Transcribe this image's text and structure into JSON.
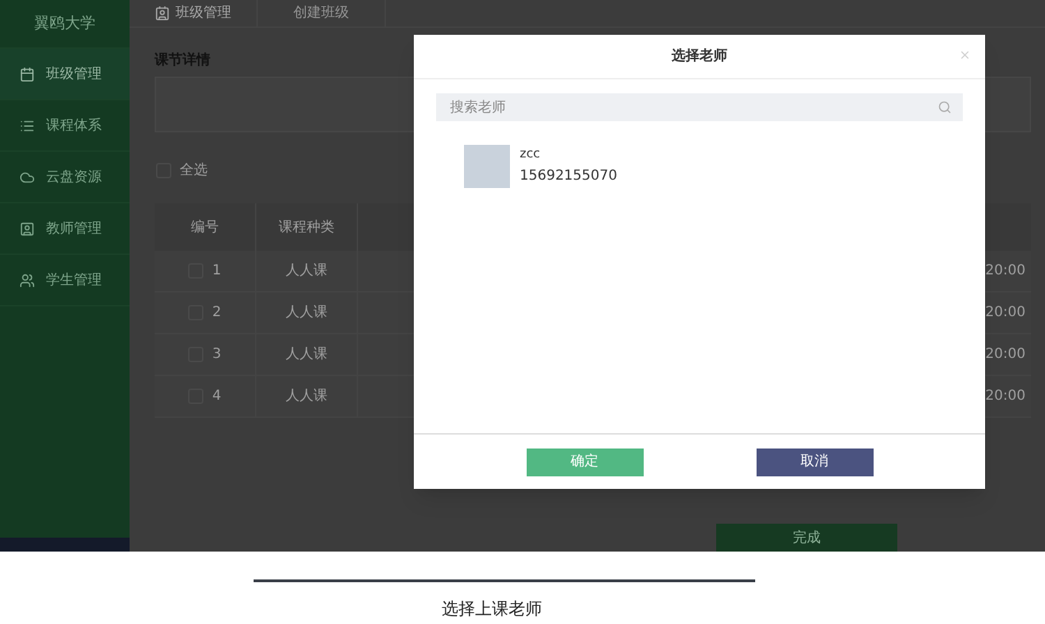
{
  "sidebar": {
    "title": "翼鸥大学",
    "items": [
      {
        "label": "班级管理",
        "kind": "calendar",
        "selected": true
      },
      {
        "label": "课程体系",
        "kind": "list",
        "selected": false
      },
      {
        "label": "云盘资源",
        "kind": "cloud",
        "selected": false
      },
      {
        "label": "教师管理",
        "kind": "person",
        "selected": false
      },
      {
        "label": "学生管理",
        "kind": "people",
        "selected": false
      }
    ]
  },
  "tabs": [
    {
      "label": "班级管理",
      "selected": true
    },
    {
      "label": "创建班级",
      "selected": false
    }
  ],
  "section_title": "课节详情",
  "select_all": {
    "label": "全选",
    "checked": false
  },
  "table": {
    "columns": [
      "编号",
      "课程种类"
    ],
    "rows": [
      {
        "number": "1",
        "type": "人人课",
        "time": "20:00",
        "checked": false
      },
      {
        "number": "2",
        "type": "人人课",
        "time": "20:00",
        "checked": false
      },
      {
        "number": "3",
        "type": "人人课",
        "time": "20:00",
        "checked": false
      },
      {
        "number": "4",
        "type": "人人课",
        "time": "20:00",
        "checked": false
      }
    ]
  },
  "done_button": "完成",
  "dialog": {
    "title": "选择老师",
    "search": {
      "placeholder": "搜索老师"
    },
    "teachers": [
      {
        "name": "zcc",
        "phone": "15692155070"
      }
    ],
    "confirm": "确定",
    "cancel": "取消"
  },
  "caption": "选择上课老师"
}
